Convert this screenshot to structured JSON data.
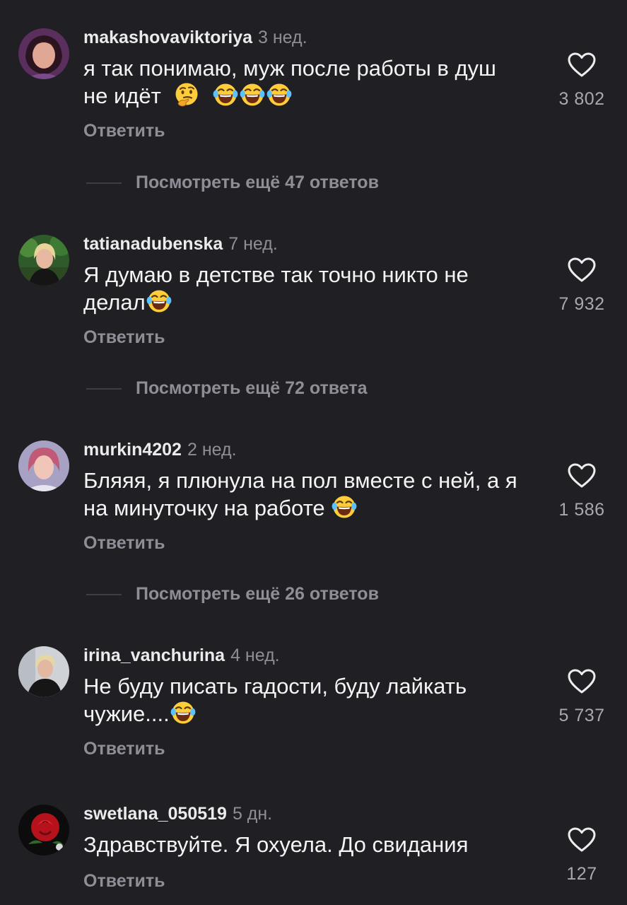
{
  "colors": {
    "background": "#1f1f24",
    "secondary_text": "#8e8e96",
    "primary_text": "#f4f4f4"
  },
  "comments": [
    {
      "username": "makashovaviktoriya",
      "age": "3 нед.",
      "text_line1": "я так понимаю, муж после работы в душ",
      "text_line2": "не идёт",
      "emojis": [
        "thinking-face",
        "tears-of-joy",
        "tears-of-joy",
        "tears-of-joy"
      ],
      "reply_label": "Ответить",
      "likes": "3 802",
      "more_replies": "Посмотреть ещё 47 ответов"
    },
    {
      "username": "tatianadubenska",
      "age": "7 нед.",
      "text_line1": "Я думаю в детстве так точно никто не",
      "text_line2": "делал",
      "emojis": [
        "tears-of-joy"
      ],
      "reply_label": "Ответить",
      "likes": "7 932",
      "more_replies": "Посмотреть ещё 72 ответа"
    },
    {
      "username": "murkin4202",
      "age": "2 нед.",
      "text_line1": "Бляяя, я плюнула на пол вместе с ней, а я",
      "text_line2": "на минуточку на работе ",
      "emojis": [
        "tears-of-joy"
      ],
      "reply_label": "Ответить",
      "likes": "1 586",
      "more_replies": "Посмотреть ещё 26 ответов"
    },
    {
      "username": "irina_vanchurina",
      "age": "4 нед.",
      "text_line1": "Не буду писать гадости, буду лайкать",
      "text_line2": "чужие....",
      "emojis": [
        "tears-of-joy"
      ],
      "reply_label": "Ответить",
      "likes": "5 737"
    },
    {
      "username": "swetlana_050519",
      "age": "5 дн.",
      "text_line1": "Здравствуйте. Я охуела. До свидания",
      "reply_label": "Ответить",
      "likes": "127"
    }
  ]
}
